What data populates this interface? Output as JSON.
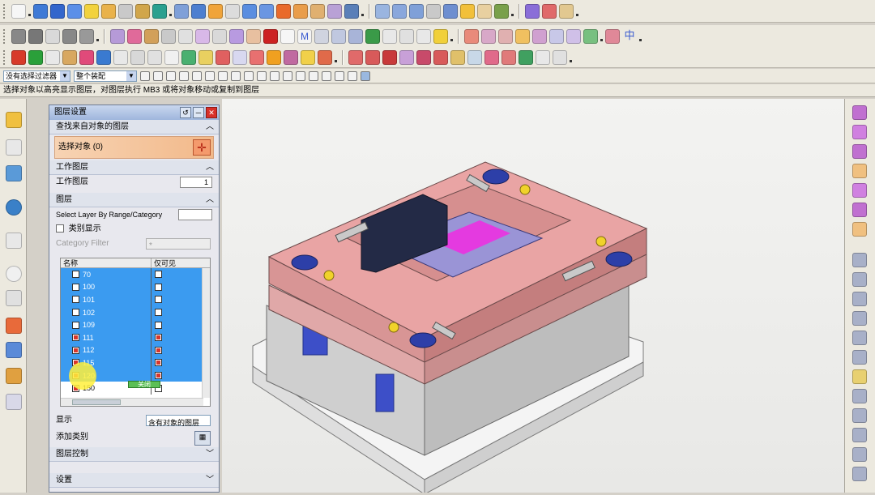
{
  "selection_bar": {
    "filter_value": "没有选择过滤器",
    "scope_value": "整个装配"
  },
  "status_text": "选择对象以高亮显示图层，对图层执行 MB3 或将对象移动或复制到图层",
  "dialog": {
    "title": "图层设置",
    "find_section": {
      "title": "查找来自对象的图层",
      "select_object_label": "选择对象 (0)"
    },
    "work_layer_section": {
      "title": "工作图层",
      "work_layer_label": "工作图层",
      "work_layer_value": "1"
    },
    "layer_section": {
      "title": "图层",
      "range_label": "Select Layer By Range/Category",
      "category_display_label": "类别显示",
      "category_filter_label": "Category Filter",
      "category_filter_value": "*",
      "columns": [
        "名称",
        "仅可见"
      ],
      "rows": [
        {
          "name": "70",
          "checked": false,
          "visible_only": false
        },
        {
          "name": "100",
          "checked": false,
          "visible_only": false
        },
        {
          "name": "101",
          "checked": false,
          "visible_only": false
        },
        {
          "name": "102",
          "checked": false,
          "visible_only": false
        },
        {
          "name": "109",
          "checked": false,
          "visible_only": false
        },
        {
          "name": "111",
          "checked": true,
          "visible_only": true
        },
        {
          "name": "112",
          "checked": true,
          "visible_only": true
        },
        {
          "name": "115",
          "checked": true,
          "visible_only": true
        },
        {
          "name": "120",
          "checked": true,
          "visible_only": true
        },
        {
          "name": "150",
          "checked": true,
          "visible_only": false
        }
      ],
      "display_label": "显示",
      "display_value": "含有对象的图层",
      "add_category_label": "添加类别",
      "layer_control_label": "图层控制"
    },
    "settings_label": "设置",
    "close_button": "关闭"
  }
}
